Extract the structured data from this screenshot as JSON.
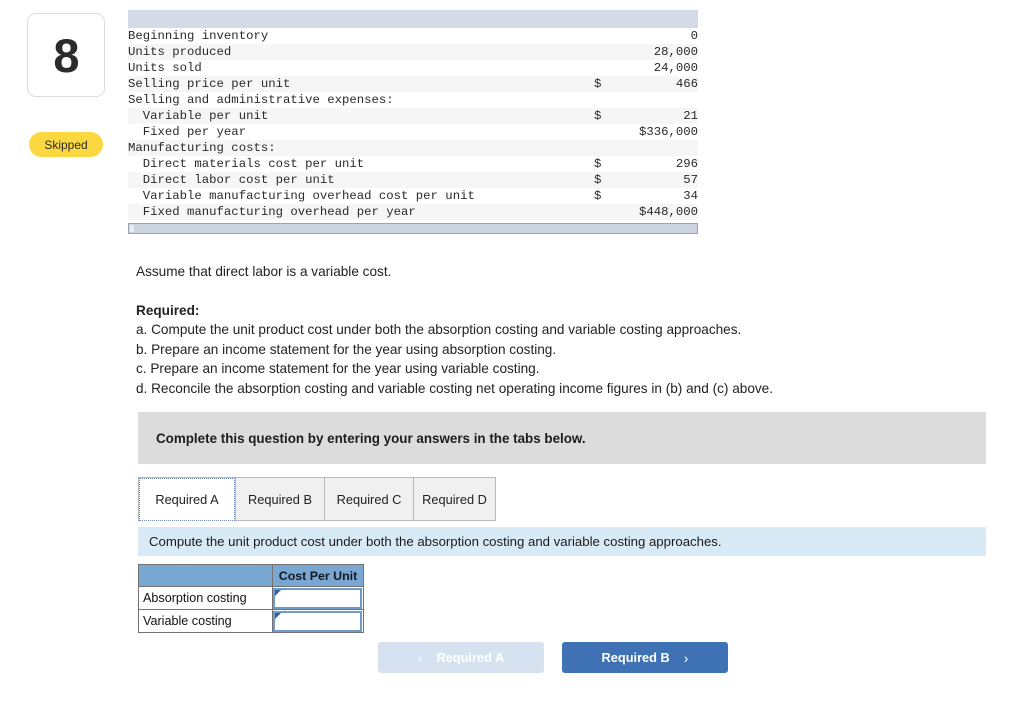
{
  "question": {
    "number": "8",
    "status_badge": "Skipped"
  },
  "data_table": {
    "rows": [
      {
        "label": "Beginning inventory",
        "currency": "",
        "value": "0"
      },
      {
        "label": "Units produced",
        "currency": "",
        "value": "28,000"
      },
      {
        "label": "Units sold",
        "currency": "",
        "value": "24,000"
      },
      {
        "label": "Selling price per unit",
        "currency": "$",
        "value": "466"
      },
      {
        "label": "Selling and administrative expenses:",
        "currency": "",
        "value": ""
      },
      {
        "label": "  Variable per unit",
        "currency": "$",
        "value": "21"
      },
      {
        "label": "  Fixed per year",
        "currency": "",
        "value": "$336,000"
      },
      {
        "label": "Manufacturing costs:",
        "currency": "",
        "value": ""
      },
      {
        "label": "  Direct materials cost per unit",
        "currency": "$",
        "value": "296"
      },
      {
        "label": "  Direct labor cost per unit",
        "currency": "$",
        "value": "57"
      },
      {
        "label": "  Variable manufacturing overhead cost per unit",
        "currency": "$",
        "value": "34"
      },
      {
        "label": "  Fixed manufacturing overhead per year",
        "currency": "",
        "value": "$448,000"
      }
    ]
  },
  "prose": {
    "assumption": "Assume that direct labor is a variable cost.",
    "required_heading": "Required:",
    "required_items": [
      "a. Compute the unit product cost under both the absorption costing and variable costing approaches.",
      "b. Prepare an income statement for the year using absorption costing.",
      "c. Prepare an income statement for the year using variable costing.",
      "d. Reconcile the absorption costing and variable costing net operating income figures in (b) and (c) above."
    ]
  },
  "banner": {
    "text": "Complete this question by entering your answers in the tabs below."
  },
  "tabs": [
    {
      "label": "Required A",
      "active": true
    },
    {
      "label": "Required B",
      "active": false
    },
    {
      "label": "Required C",
      "active": false
    },
    {
      "label": "Required D",
      "active": false
    }
  ],
  "tab_instruction": "Compute the unit product cost under both the absorption costing and variable costing approaches.",
  "answer_grid": {
    "header": [
      "",
      "Cost Per Unit"
    ],
    "rows": [
      {
        "label": "Absorption costing",
        "value": ""
      },
      {
        "label": "Variable costing",
        "value": ""
      }
    ]
  },
  "nav": {
    "prev_label": "Required A",
    "next_label": "Required B",
    "prev_icon": "chevron-left",
    "next_icon": "chevron-right",
    "prev_chevron": "‹",
    "next_chevron": "›",
    "prev_disabled": true
  },
  "colors": {
    "badge_yellow": "#fbd83f",
    "banner_gray": "#dcdcdc",
    "strip_blue": "#d9eaf7",
    "grid_header_blue": "#7aa6d2",
    "button_blue": "#3f72b4",
    "button_disabled_blue": "#d7e2f1",
    "data_head_bar": "#d4dae6"
  }
}
